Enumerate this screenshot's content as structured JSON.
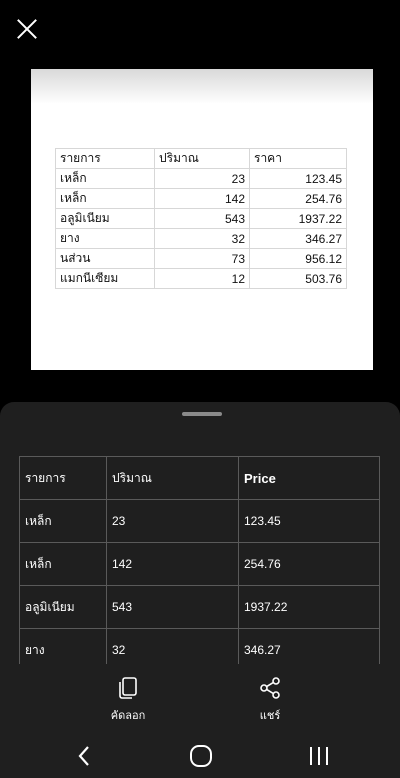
{
  "preview": {
    "headers": [
      "รายการ",
      "ปริมาณ",
      "ราคา"
    ],
    "rows": [
      [
        "เหล็ก",
        "23",
        "123.45"
      ],
      [
        "เหล็ก",
        "142",
        "254.76"
      ],
      [
        "อลูมิเนียม",
        "543",
        "1937.22"
      ],
      [
        "ยาง",
        "32",
        "346.27"
      ],
      [
        "นส่วน",
        "73",
        "956.12"
      ],
      [
        "แมกนีเซียม",
        "12",
        "503.76"
      ]
    ]
  },
  "result": {
    "headers": [
      "รายการ",
      "ปริมาณ",
      "Price"
    ],
    "rows": [
      [
        "เหล็ก",
        "23",
        "123.45"
      ],
      [
        "เหล็ก",
        "142",
        "254.76"
      ],
      [
        "อลูมิเนียม",
        "543",
        "1937.22"
      ],
      [
        "ยาง",
        "32",
        "346.27"
      ]
    ]
  },
  "actions": {
    "copy_label": "คัดลอก",
    "share_label": "แชร์"
  },
  "icons": {
    "close": "close-icon",
    "copy": "copy-icon",
    "share": "share-icon",
    "back": "back-icon",
    "home": "home-icon",
    "recents": "recents-icon"
  }
}
